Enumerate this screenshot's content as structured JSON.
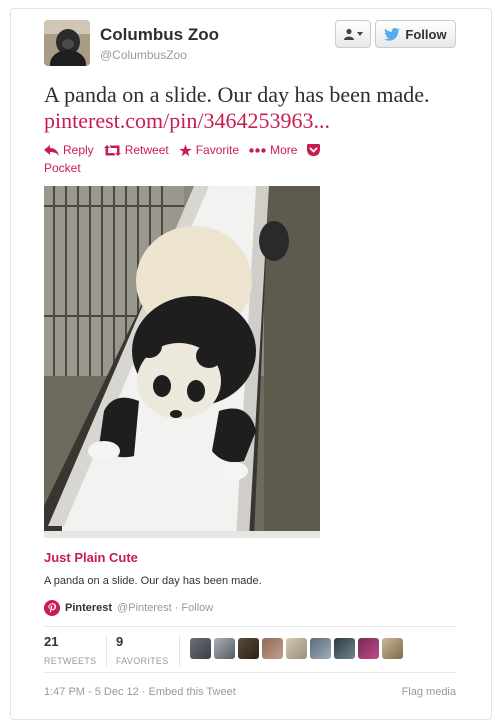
{
  "user": {
    "name": "Columbus Zoo",
    "handle": "@ColumbusZoo",
    "follow_label": "Follow"
  },
  "tweet": {
    "text": "A panda on a slide. Our day has been made.",
    "link": "pinterest.com/pin/3464253963..."
  },
  "actions": {
    "reply": "Reply",
    "retweet": "Retweet",
    "favorite": "Favorite",
    "more": "More",
    "pocket": "Pocket"
  },
  "card": {
    "title": "Just Plain Cute",
    "description": "A panda on a slide. Our day has been made.",
    "source_name": "Pinterest",
    "source_meta": "@Pinterest · Follow"
  },
  "stats": {
    "retweets_count": "21",
    "retweets_label": "RETWEETS",
    "favorites_count": "9",
    "favorites_label": "FAVORITES"
  },
  "footer": {
    "meta": "1:47 PM - 5 Dec 12 · Embed this Tweet",
    "flag": "Flag media"
  },
  "colors": {
    "accent": "#c91d4f",
    "twitter_blue": "#55acee"
  }
}
